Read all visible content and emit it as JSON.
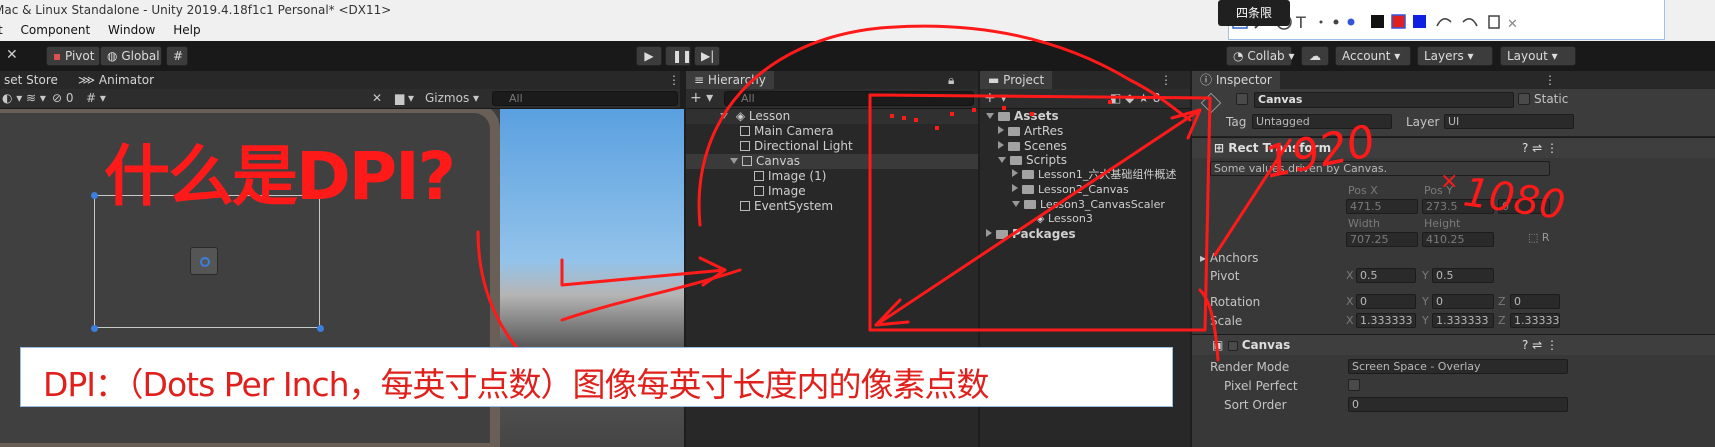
{
  "window": {
    "title": "Mac & Linux Standalone - Unity 2019.4.18f1c1 Personal* <DX11>"
  },
  "menu": {
    "items": [
      "t",
      "Component",
      "Window",
      "Help"
    ]
  },
  "toolbar": {
    "pivot": "Pivot",
    "global": "Global",
    "collab": "Collab",
    "account": "Account",
    "layers": "Layers",
    "layout": "Layout"
  },
  "annotation_toolbar": {
    "tooltip": "四条限"
  },
  "scene": {
    "tab_store": "set Store",
    "tab_animator": "Animator",
    "gizmos": "Gizmos",
    "search_placeholder": "All",
    "hidden_count": "0",
    "overlay_title": "什么是DPI?"
  },
  "hierarchy": {
    "tab": "Hierarchy",
    "search_placeholder": "All",
    "items": [
      "Lesson",
      "Main Camera",
      "Directional Light",
      "Canvas",
      "Image (1)",
      "Image",
      "EventSystem"
    ]
  },
  "project": {
    "tab": "Project",
    "items": [
      "Assets",
      "ArtRes",
      "Scenes",
      "Scripts",
      "Lesson1_六大基础组件概述",
      "Lesson2_Canvas",
      "Lesson3_CanvasScaler",
      "Lesson3",
      "Packages"
    ]
  },
  "inspector": {
    "tab": "Inspector",
    "object_name": "Canvas",
    "static_label": "Static",
    "tag_label": "Tag",
    "tag_value": "Untagged",
    "layer_label": "Layer",
    "layer_value": "UI",
    "rect_transform": "Rect Transform",
    "driven_note": "Some values driven by Canvas.",
    "pos_x_label": "Pos X",
    "pos_x": "471.5",
    "pos_y_label": "Pos Y",
    "pos_y": "273.5",
    "pos_z": "0",
    "width_label": "Width",
    "width": "707.25",
    "height_label": "Height",
    "height": "410.25",
    "anchors": "Anchors",
    "pivot_label": "Pivot",
    "pivot_x": "0.5",
    "pivot_y": "0.5",
    "rotation_label": "Rotation",
    "rot_x": "0",
    "rot_y": "0",
    "rot_z": "0",
    "scale_label": "Scale",
    "scale_x": "1.333333",
    "scale_y": "1.333333",
    "scale_z": "1.333333",
    "canvas_section": "Canvas",
    "render_mode_label": "Render Mode",
    "render_mode_value": "Screen Space - Overlay",
    "pixel_perfect_label": "Pixel Perfect",
    "sort_order_label": "Sort Order",
    "sort_order_value": "0"
  },
  "handwriting": {
    "res_w": "1920",
    "res_h": "1080"
  },
  "banner": {
    "text": "DPI：（Dots Per Inch，每英寸点数）图像每英寸长度内的像素点数"
  },
  "colors": {
    "annotation_red": "#ff1a1a",
    "unity_dark": "#282828",
    "banner_bg": "#ffffff"
  }
}
